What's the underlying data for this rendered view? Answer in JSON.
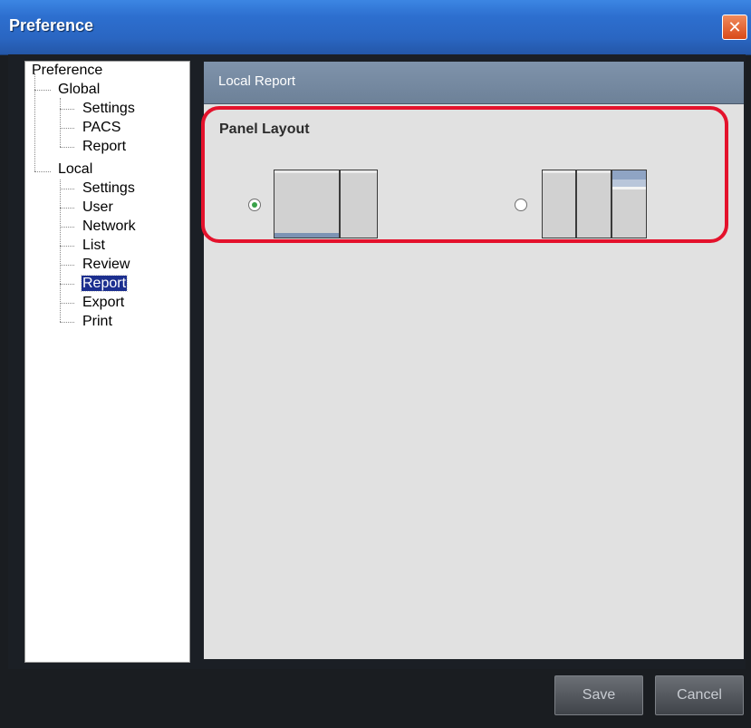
{
  "window": {
    "title": "Preference",
    "close_icon": "close-icon"
  },
  "tree": {
    "items": [
      {
        "label": "Preference",
        "level": 0
      },
      {
        "label": "Global",
        "level": 1
      },
      {
        "label": "Settings",
        "level": 2
      },
      {
        "label": "PACS",
        "level": 2
      },
      {
        "label": "Report",
        "level": 2
      },
      {
        "label": "Local",
        "level": 1
      },
      {
        "label": "Settings",
        "level": 2
      },
      {
        "label": "User",
        "level": 2
      },
      {
        "label": "Network",
        "level": 2
      },
      {
        "label": "List",
        "level": 2
      },
      {
        "label": "Review",
        "level": 2
      },
      {
        "label": "Report",
        "level": 2,
        "selected": true
      },
      {
        "label": "Export",
        "level": 2
      },
      {
        "label": "Print",
        "level": 2
      }
    ]
  },
  "panel": {
    "header": "Local Report",
    "section_title": "Panel Layout",
    "layout_options": [
      {
        "name": "two-pane-layout",
        "selected": true
      },
      {
        "name": "three-pane-layout",
        "selected": false
      }
    ]
  },
  "footer": {
    "save_label": "Save",
    "cancel_label": "Cancel"
  },
  "colors": {
    "titlebar": "#2d6fcf",
    "selection": "#1c2f8f",
    "highlight_border": "#e4122c",
    "radio_selected": "#3aa24a"
  }
}
